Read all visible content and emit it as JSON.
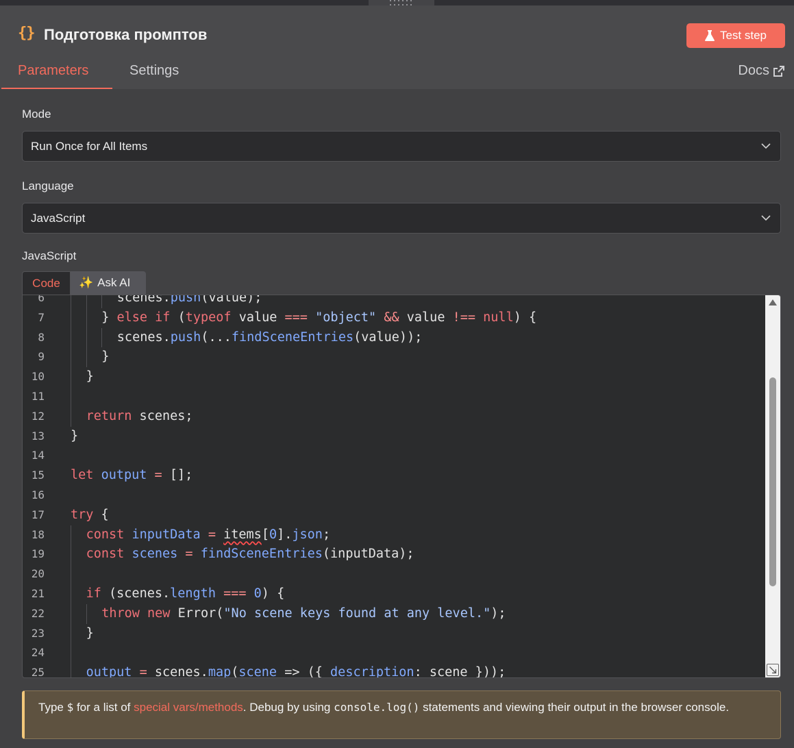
{
  "node": {
    "icon": "{}",
    "title": "Подготовка промптов"
  },
  "header": {
    "test_step_label": "Test step"
  },
  "tabs": [
    {
      "label": "Parameters"
    },
    {
      "label": "Settings"
    }
  ],
  "docs": {
    "label": "Docs"
  },
  "mode": {
    "label": "Mode",
    "value": "Run Once for All Items"
  },
  "language": {
    "label": "Language",
    "value": "JavaScript"
  },
  "code_section": {
    "label": "JavaScript",
    "tab_code": "Code",
    "tab_ask_ai": "Ask AI"
  },
  "code": {
    "lines": [
      {
        "n": "6",
        "text": "scenes.push(value);"
      },
      {
        "n": "7",
        "text": "} else if (typeof value === \"object\" && value !== null) {"
      },
      {
        "n": "8",
        "text": "scenes.push(...findSceneEntries(value));"
      },
      {
        "n": "9",
        "text": "}"
      },
      {
        "n": "10",
        "text": "}"
      },
      {
        "n": "11",
        "text": ""
      },
      {
        "n": "12",
        "text": "return scenes;"
      },
      {
        "n": "13",
        "text": "}"
      },
      {
        "n": "14",
        "text": ""
      },
      {
        "n": "15",
        "text": "let output = [];"
      },
      {
        "n": "16",
        "text": ""
      },
      {
        "n": "17",
        "text": "try {"
      },
      {
        "n": "18",
        "text": "const inputData = items[0].json;"
      },
      {
        "n": "19",
        "text": "const scenes = findSceneEntries(inputData);"
      },
      {
        "n": "20",
        "text": ""
      },
      {
        "n": "21",
        "text": "if (scenes.length === 0) {"
      },
      {
        "n": "22",
        "text": "throw new Error(\"No scene keys found at any level.\");"
      },
      {
        "n": "23",
        "text": "}"
      },
      {
        "n": "24",
        "text": ""
      },
      {
        "n": "25",
        "text": "output = scenes.map(scene => ({ description: scene }));"
      }
    ]
  },
  "hint": {
    "prefix": "Type ",
    "dollar": "$",
    "mid1": " for a list of ",
    "link": "special vars/methods",
    "mid2": ". Debug by using ",
    "code": "console.log()",
    "suffix": " statements and viewing their output in the browser console."
  },
  "colors": {
    "accent": "#f36b5c",
    "icon": "#f7a54b",
    "hint_bg": "#5e5240"
  },
  "icons": {
    "flask": "flask-icon",
    "docs_external": "external-link-icon",
    "sparkle": "sparkle-icon",
    "chevron": "chevron-down-icon"
  }
}
